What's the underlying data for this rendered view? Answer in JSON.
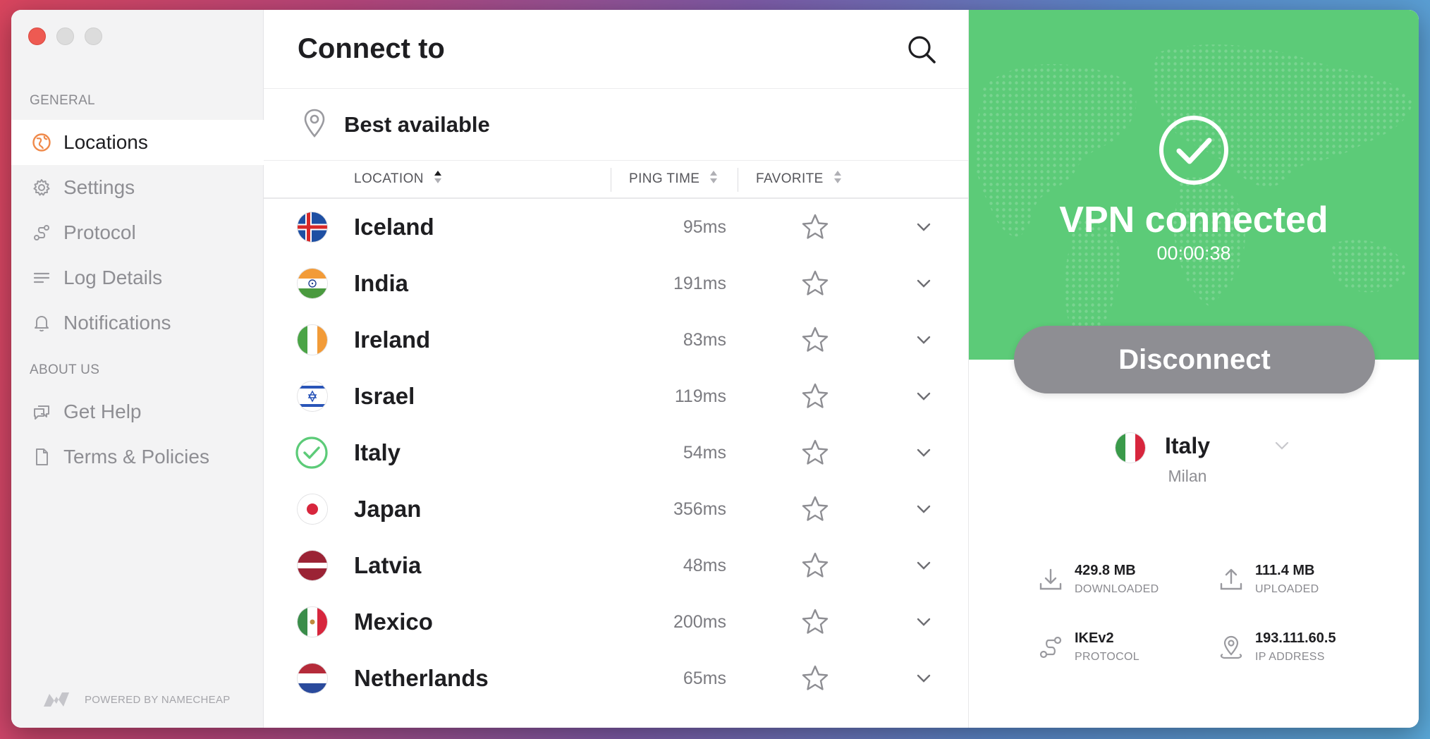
{
  "sidebar": {
    "section_general": "GENERAL",
    "section_about": "ABOUT US",
    "items": [
      {
        "label": "Locations",
        "icon": "globe-icon",
        "active": true
      },
      {
        "label": "Settings",
        "icon": "gear-icon",
        "active": false
      },
      {
        "label": "Protocol",
        "icon": "protocol-icon",
        "active": false
      },
      {
        "label": "Log Details",
        "icon": "list-icon",
        "active": false
      },
      {
        "label": "Notifications",
        "icon": "bell-icon",
        "active": false
      }
    ],
    "about_items": [
      {
        "label": "Get Help",
        "icon": "chat-icon"
      },
      {
        "label": "Terms & Policies",
        "icon": "document-icon"
      }
    ],
    "powered_by": "POWERED BY NAMECHEAP"
  },
  "main": {
    "title": "Connect to",
    "best_available": "Best available",
    "columns": {
      "location": "LOCATION",
      "ping": "PING TIME",
      "favorite": "FAVORITE"
    },
    "rows": [
      {
        "country": "Iceland",
        "ping": "95ms",
        "flag": "iceland-flag"
      },
      {
        "country": "India",
        "ping": "191ms",
        "flag": "india-flag"
      },
      {
        "country": "Ireland",
        "ping": "83ms",
        "flag": "ireland-flag"
      },
      {
        "country": "Israel",
        "ping": "119ms",
        "flag": "israel-flag"
      },
      {
        "country": "Italy",
        "ping": "54ms",
        "flag": "connected-check-icon"
      },
      {
        "country": "Japan",
        "ping": "356ms",
        "flag": "japan-flag"
      },
      {
        "country": "Latvia",
        "ping": "48ms",
        "flag": "latvia-flag"
      },
      {
        "country": "Mexico",
        "ping": "200ms",
        "flag": "mexico-flag"
      },
      {
        "country": "Netherlands",
        "ping": "65ms",
        "flag": "netherlands-flag"
      }
    ]
  },
  "status": {
    "title": "VPN connected",
    "timer": "00:00:38",
    "disconnect_label": "Disconnect",
    "country": "Italy",
    "city": "Milan",
    "downloaded_value": "429.8 MB",
    "downloaded_label": "DOWNLOADED",
    "uploaded_value": "111.4 MB",
    "uploaded_label": "UPLOADED",
    "protocol_value": "IKEv2",
    "protocol_label": "PROTOCOL",
    "ip_value": "193.111.60.5",
    "ip_label": "IP ADDRESS"
  },
  "colors": {
    "accent_green": "#5ccb78",
    "disconnect_gray": "#8e8e93",
    "active_icon_orange": "#f08a4b"
  }
}
